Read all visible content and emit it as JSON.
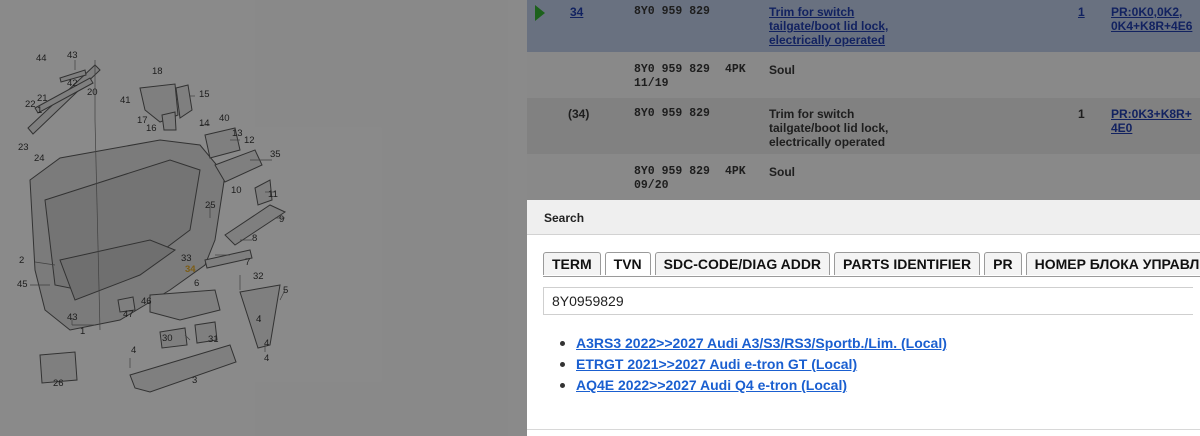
{
  "diagram": {
    "callouts": [
      "44",
      "43",
      "42",
      "20",
      "18",
      "15",
      "41",
      "21",
      "22",
      "1",
      "17",
      "16",
      "14",
      "40",
      "13",
      "12",
      "23",
      "24",
      "35",
      "10",
      "11",
      "25",
      "9",
      "8",
      "2",
      "7",
      "33",
      "34",
      "45",
      "6",
      "32",
      "5",
      "46",
      "47",
      "43",
      "1",
      "4",
      "4",
      "30",
      "31",
      "4",
      "4",
      "26",
      "3"
    ]
  },
  "parts_table": {
    "rows": [
      {
        "pos": "34",
        "part": "8Y0 959 829",
        "code": "",
        "desc": [
          "Trim for switch",
          "tailgate/boot lid lock,",
          "electrically operated"
        ],
        "qty": "1",
        "pr": [
          "PR:0K0,0K2,",
          "0K4+K8R+4E6"
        ]
      },
      {
        "pos": "",
        "part": "8Y0 959 829",
        "date": "11/19",
        "code": "4PK",
        "desc": [
          "Soul"
        ],
        "qty": "",
        "pr": []
      },
      {
        "pos": "(34)",
        "part": "8Y0 959 829",
        "code": "",
        "desc": [
          "Trim for switch",
          "tailgate/boot lid lock,",
          "electrically operated"
        ],
        "qty": "1",
        "pr": [
          "PR:0K3+K8R+",
          "4E0"
        ]
      },
      {
        "pos": "",
        "part": "8Y0 959 829",
        "date": "09/20",
        "code": "4PK",
        "desc": [
          "Soul"
        ],
        "qty": "",
        "pr": []
      }
    ]
  },
  "search_dialog": {
    "title": "Search",
    "tabs": [
      "TERM",
      "TVN",
      "SDC-CODE/DIAG ADDR",
      "PARTS IDENTIFIER",
      "PR",
      "НОМЕР БЛОКА УПРАВЛ"
    ],
    "active_tab": "TVN",
    "query": "8Y0959829",
    "results": [
      "A3RS3 2022>>2027 Audi A3/S3/RS3/Sportb./Lim. (Local)",
      "ETRGT 2021>>2027 Audi e-tron GT (Local)",
      "AQ4E 2022>>2027 Audi Q4 e-tron (Local)"
    ]
  },
  "colors": {
    "selected_row": "#b9c9e6",
    "link": "#1a5fd0",
    "pr_link": "#0a2aa6",
    "highlight_callout": "#e0a010",
    "arrow": "#1fa81f"
  },
  "icons": {
    "selected_row_marker": "play-arrow-icon",
    "result_bullet": "bullet-icon"
  }
}
